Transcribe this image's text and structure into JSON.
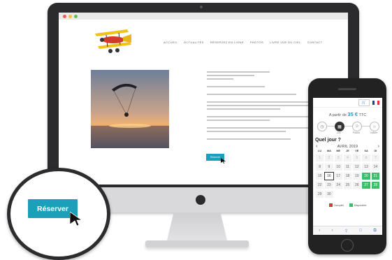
{
  "colors": {
    "accent": "#1aa0b9",
    "available": "#3dbe6a",
    "complet": "#e0333a",
    "window_red": "#ec5b55",
    "window_yellow": "#f2be3f",
    "window_green": "#5cc24d"
  },
  "desktop": {
    "nav": [
      "ACCUEIL",
      "ACTUALITÉS",
      "RÉSERVEZ EN LIGNE",
      "PHOTOS",
      "LIVRE VUE DU CIEL",
      "CONTACT"
    ],
    "reserve_label": "Réserver"
  },
  "magnified": {
    "reserve_label": "Réserver"
  },
  "phone": {
    "cart_icon": "cart-icon",
    "price_prefix": "A partir de",
    "price_value": "35 €",
    "price_suffix": "TTC",
    "steps": [
      {
        "icon": "clock-icon",
        "label": ""
      },
      {
        "icon": "calendar-icon",
        "label": "Jour"
      },
      {
        "icon": "person-icon",
        "label": "Places"
      },
      {
        "icon": "star-icon",
        "label": "Valider"
      }
    ],
    "question": "Quel jour ?",
    "month": "AVRIL 2019",
    "prev_arrow": "‹",
    "next_arrow": "›",
    "weekdays": [
      "LU",
      "MA",
      "ME",
      "JE",
      "VE",
      "SA",
      "DI"
    ],
    "days": [
      {
        "t": "1",
        "s": "faded"
      },
      {
        "t": "2",
        "s": "faded"
      },
      {
        "t": "3",
        "s": "faded"
      },
      {
        "t": "4",
        "s": "faded"
      },
      {
        "t": "5",
        "s": "faded"
      },
      {
        "t": "6",
        "s": "faded"
      },
      {
        "t": "7",
        "s": "faded"
      },
      {
        "t": "8",
        "s": ""
      },
      {
        "t": "9",
        "s": ""
      },
      {
        "t": "10",
        "s": ""
      },
      {
        "t": "11",
        "s": ""
      },
      {
        "t": "12",
        "s": ""
      },
      {
        "t": "13",
        "s": ""
      },
      {
        "t": "14",
        "s": ""
      },
      {
        "t": "15",
        "s": ""
      },
      {
        "t": "16",
        "s": "sel"
      },
      {
        "t": "17",
        "s": ""
      },
      {
        "t": "18",
        "s": ""
      },
      {
        "t": "19",
        "s": ""
      },
      {
        "t": "20",
        "s": "avail"
      },
      {
        "t": "21",
        "s": "avail"
      },
      {
        "t": "22",
        "s": ""
      },
      {
        "t": "23",
        "s": ""
      },
      {
        "t": "24",
        "s": ""
      },
      {
        "t": "25",
        "s": ""
      },
      {
        "t": "26",
        "s": ""
      },
      {
        "t": "27",
        "s": "avail"
      },
      {
        "t": "28",
        "s": "avail"
      },
      {
        "t": "29",
        "s": ""
      },
      {
        "t": "30",
        "s": ""
      },
      {
        "t": "",
        "s": "empty"
      },
      {
        "t": "",
        "s": "empty"
      },
      {
        "t": "",
        "s": "empty"
      },
      {
        "t": "",
        "s": "empty"
      },
      {
        "t": "",
        "s": "empty"
      }
    ],
    "legend_complet": "Complet",
    "legend_disponible": "Disponible",
    "bottom_icons": [
      "‹",
      "›",
      "⇪",
      "□",
      "⧉"
    ]
  }
}
